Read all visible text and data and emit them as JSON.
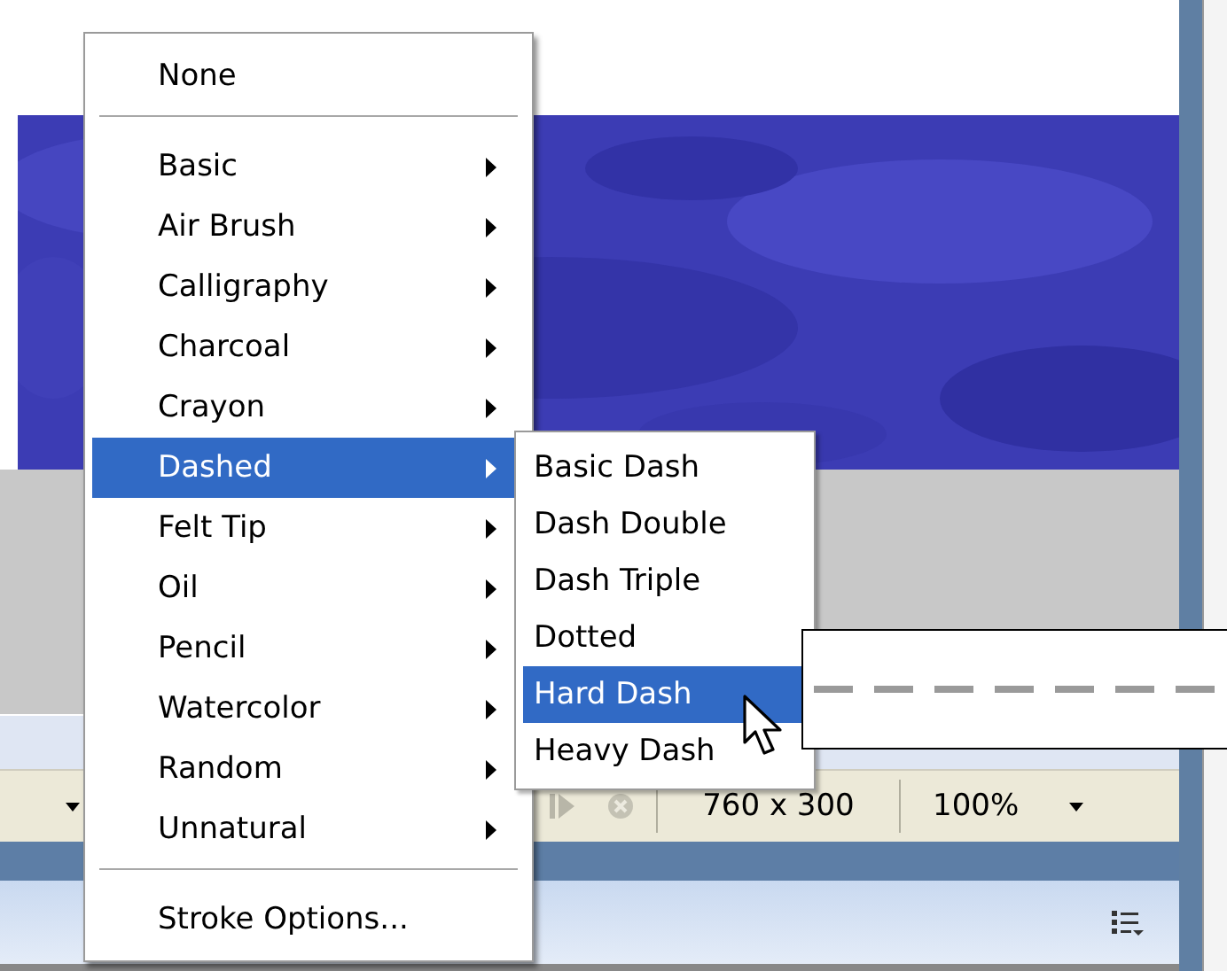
{
  "menu": {
    "items": [
      {
        "kind": "item",
        "label": "None",
        "submenu": false,
        "selected": false
      },
      {
        "kind": "separator"
      },
      {
        "kind": "item",
        "label": "Basic",
        "submenu": true,
        "selected": false
      },
      {
        "kind": "item",
        "label": "Air Brush",
        "submenu": true,
        "selected": false
      },
      {
        "kind": "item",
        "label": "Calligraphy",
        "submenu": true,
        "selected": false
      },
      {
        "kind": "item",
        "label": "Charcoal",
        "submenu": true,
        "selected": false
      },
      {
        "kind": "item",
        "label": "Crayon",
        "submenu": true,
        "selected": false
      },
      {
        "kind": "item",
        "label": "Dashed",
        "submenu": true,
        "selected": true
      },
      {
        "kind": "item",
        "label": "Felt Tip",
        "submenu": true,
        "selected": false
      },
      {
        "kind": "item",
        "label": "Oil",
        "submenu": true,
        "selected": false
      },
      {
        "kind": "item",
        "label": "Pencil",
        "submenu": true,
        "selected": false
      },
      {
        "kind": "item",
        "label": "Watercolor",
        "submenu": true,
        "selected": false
      },
      {
        "kind": "item",
        "label": "Random",
        "submenu": true,
        "selected": false
      },
      {
        "kind": "item",
        "label": "Unnatural",
        "submenu": true,
        "selected": false
      },
      {
        "kind": "separator"
      },
      {
        "kind": "item",
        "label": "Stroke Options...",
        "submenu": false,
        "selected": false
      }
    ]
  },
  "submenu": {
    "items": [
      {
        "label": "Basic Dash",
        "selected": false
      },
      {
        "label": "Dash Double",
        "selected": false
      },
      {
        "label": "Dash Triple",
        "selected": false
      },
      {
        "label": "Dotted",
        "selected": false
      },
      {
        "label": "Hard Dash",
        "selected": true
      },
      {
        "label": "Heavy Dash",
        "selected": false
      }
    ]
  },
  "status_bar": {
    "size": "760 x 300",
    "zoom": "100%"
  }
}
